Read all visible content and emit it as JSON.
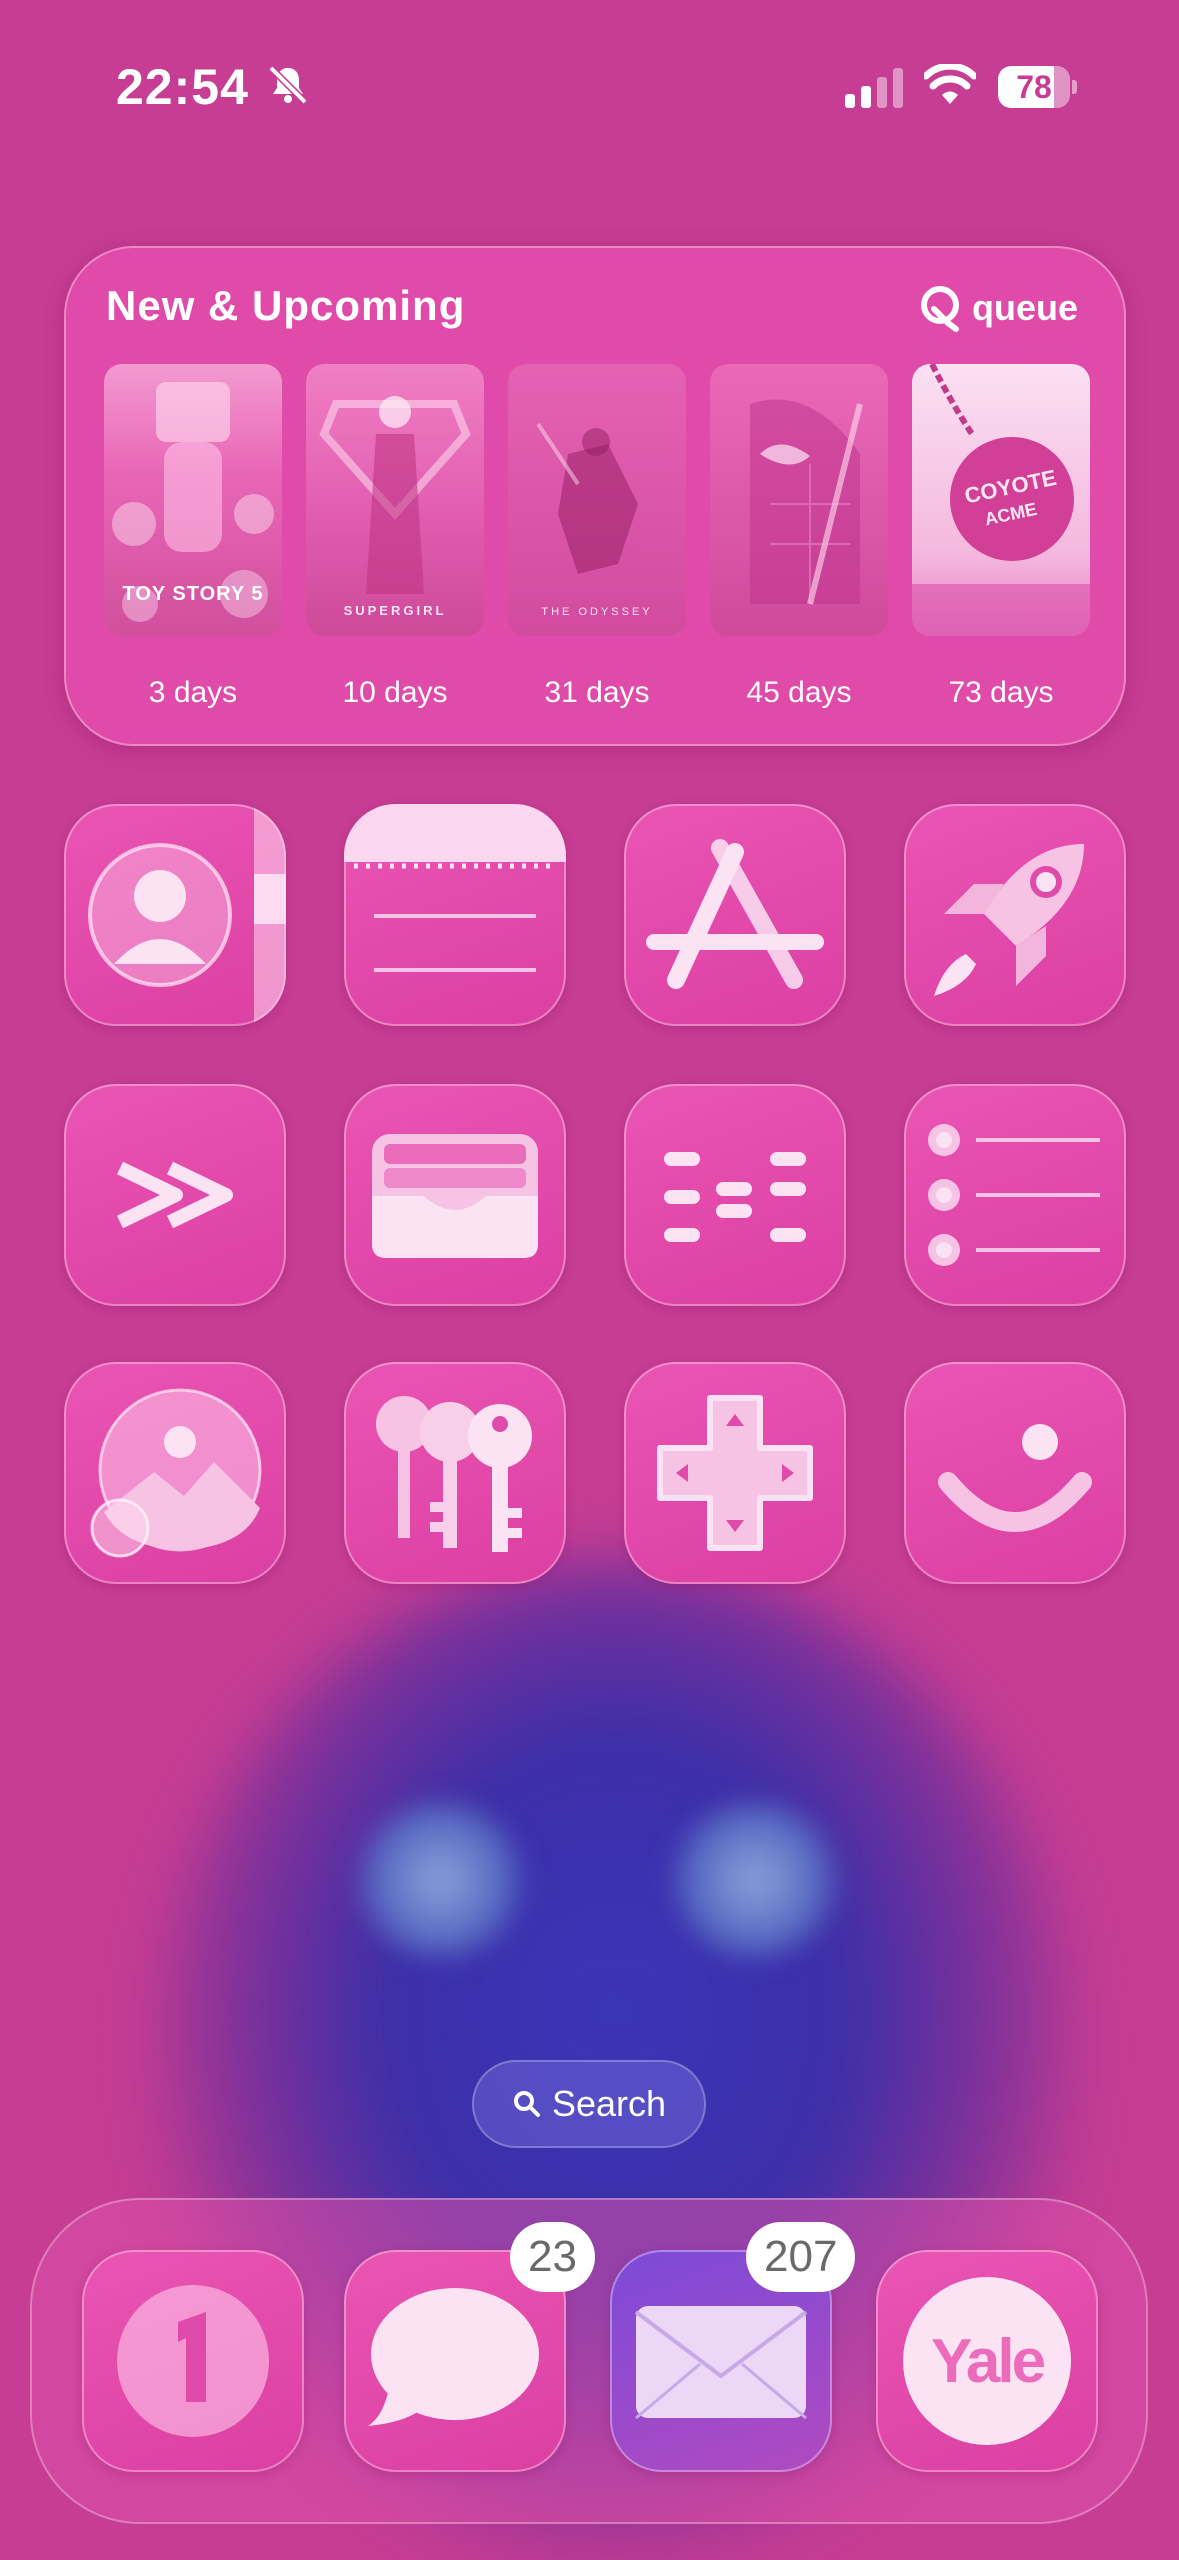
{
  "status_bar": {
    "time": "22:54",
    "battery_level": "78",
    "battery_fraction": 0.78,
    "silent_mode_icon": "bell-slash-icon",
    "signal_bars_active": 2,
    "signal_bars_total": 4
  },
  "widget": {
    "title": "New & Upcoming",
    "brand": "queue",
    "items": [
      {
        "poster_text": "TOY STORY 5",
        "countdown": "3 days"
      },
      {
        "poster_text": "SUPERGIRL",
        "countdown": "10 days"
      },
      {
        "poster_text": "THE ODYSSEY",
        "countdown": "31 days"
      },
      {
        "poster_text": "",
        "countdown": "45 days"
      },
      {
        "poster_text": "COYOTE vs. ACME",
        "countdown": "73 days"
      }
    ]
  },
  "apps": [
    {
      "icon": "contacts-icon"
    },
    {
      "icon": "notes-icon"
    },
    {
      "icon": "app-store-icon"
    },
    {
      "icon": "rocket-icon"
    },
    {
      "icon": "fast-forward-icon"
    },
    {
      "icon": "wallet-icon"
    },
    {
      "icon": "sliders-icon"
    },
    {
      "icon": "reminders-icon"
    },
    {
      "icon": "photo-bubble-icon"
    },
    {
      "icon": "keys-icon"
    },
    {
      "icon": "game-controller-dpad-icon"
    },
    {
      "icon": "smile-icon"
    }
  ],
  "search": {
    "label": "Search"
  },
  "dock": [
    {
      "icon": "one-app-icon",
      "badge": ""
    },
    {
      "icon": "messages-icon",
      "badge": "23"
    },
    {
      "icon": "mail-icon",
      "badge": "207"
    },
    {
      "icon": "yale-icon",
      "label": "Yale",
      "badge": ""
    }
  ],
  "colors": {
    "background": "#c63d93",
    "icon_fill": "#e04aa9",
    "tint": "#f8d6ee"
  }
}
